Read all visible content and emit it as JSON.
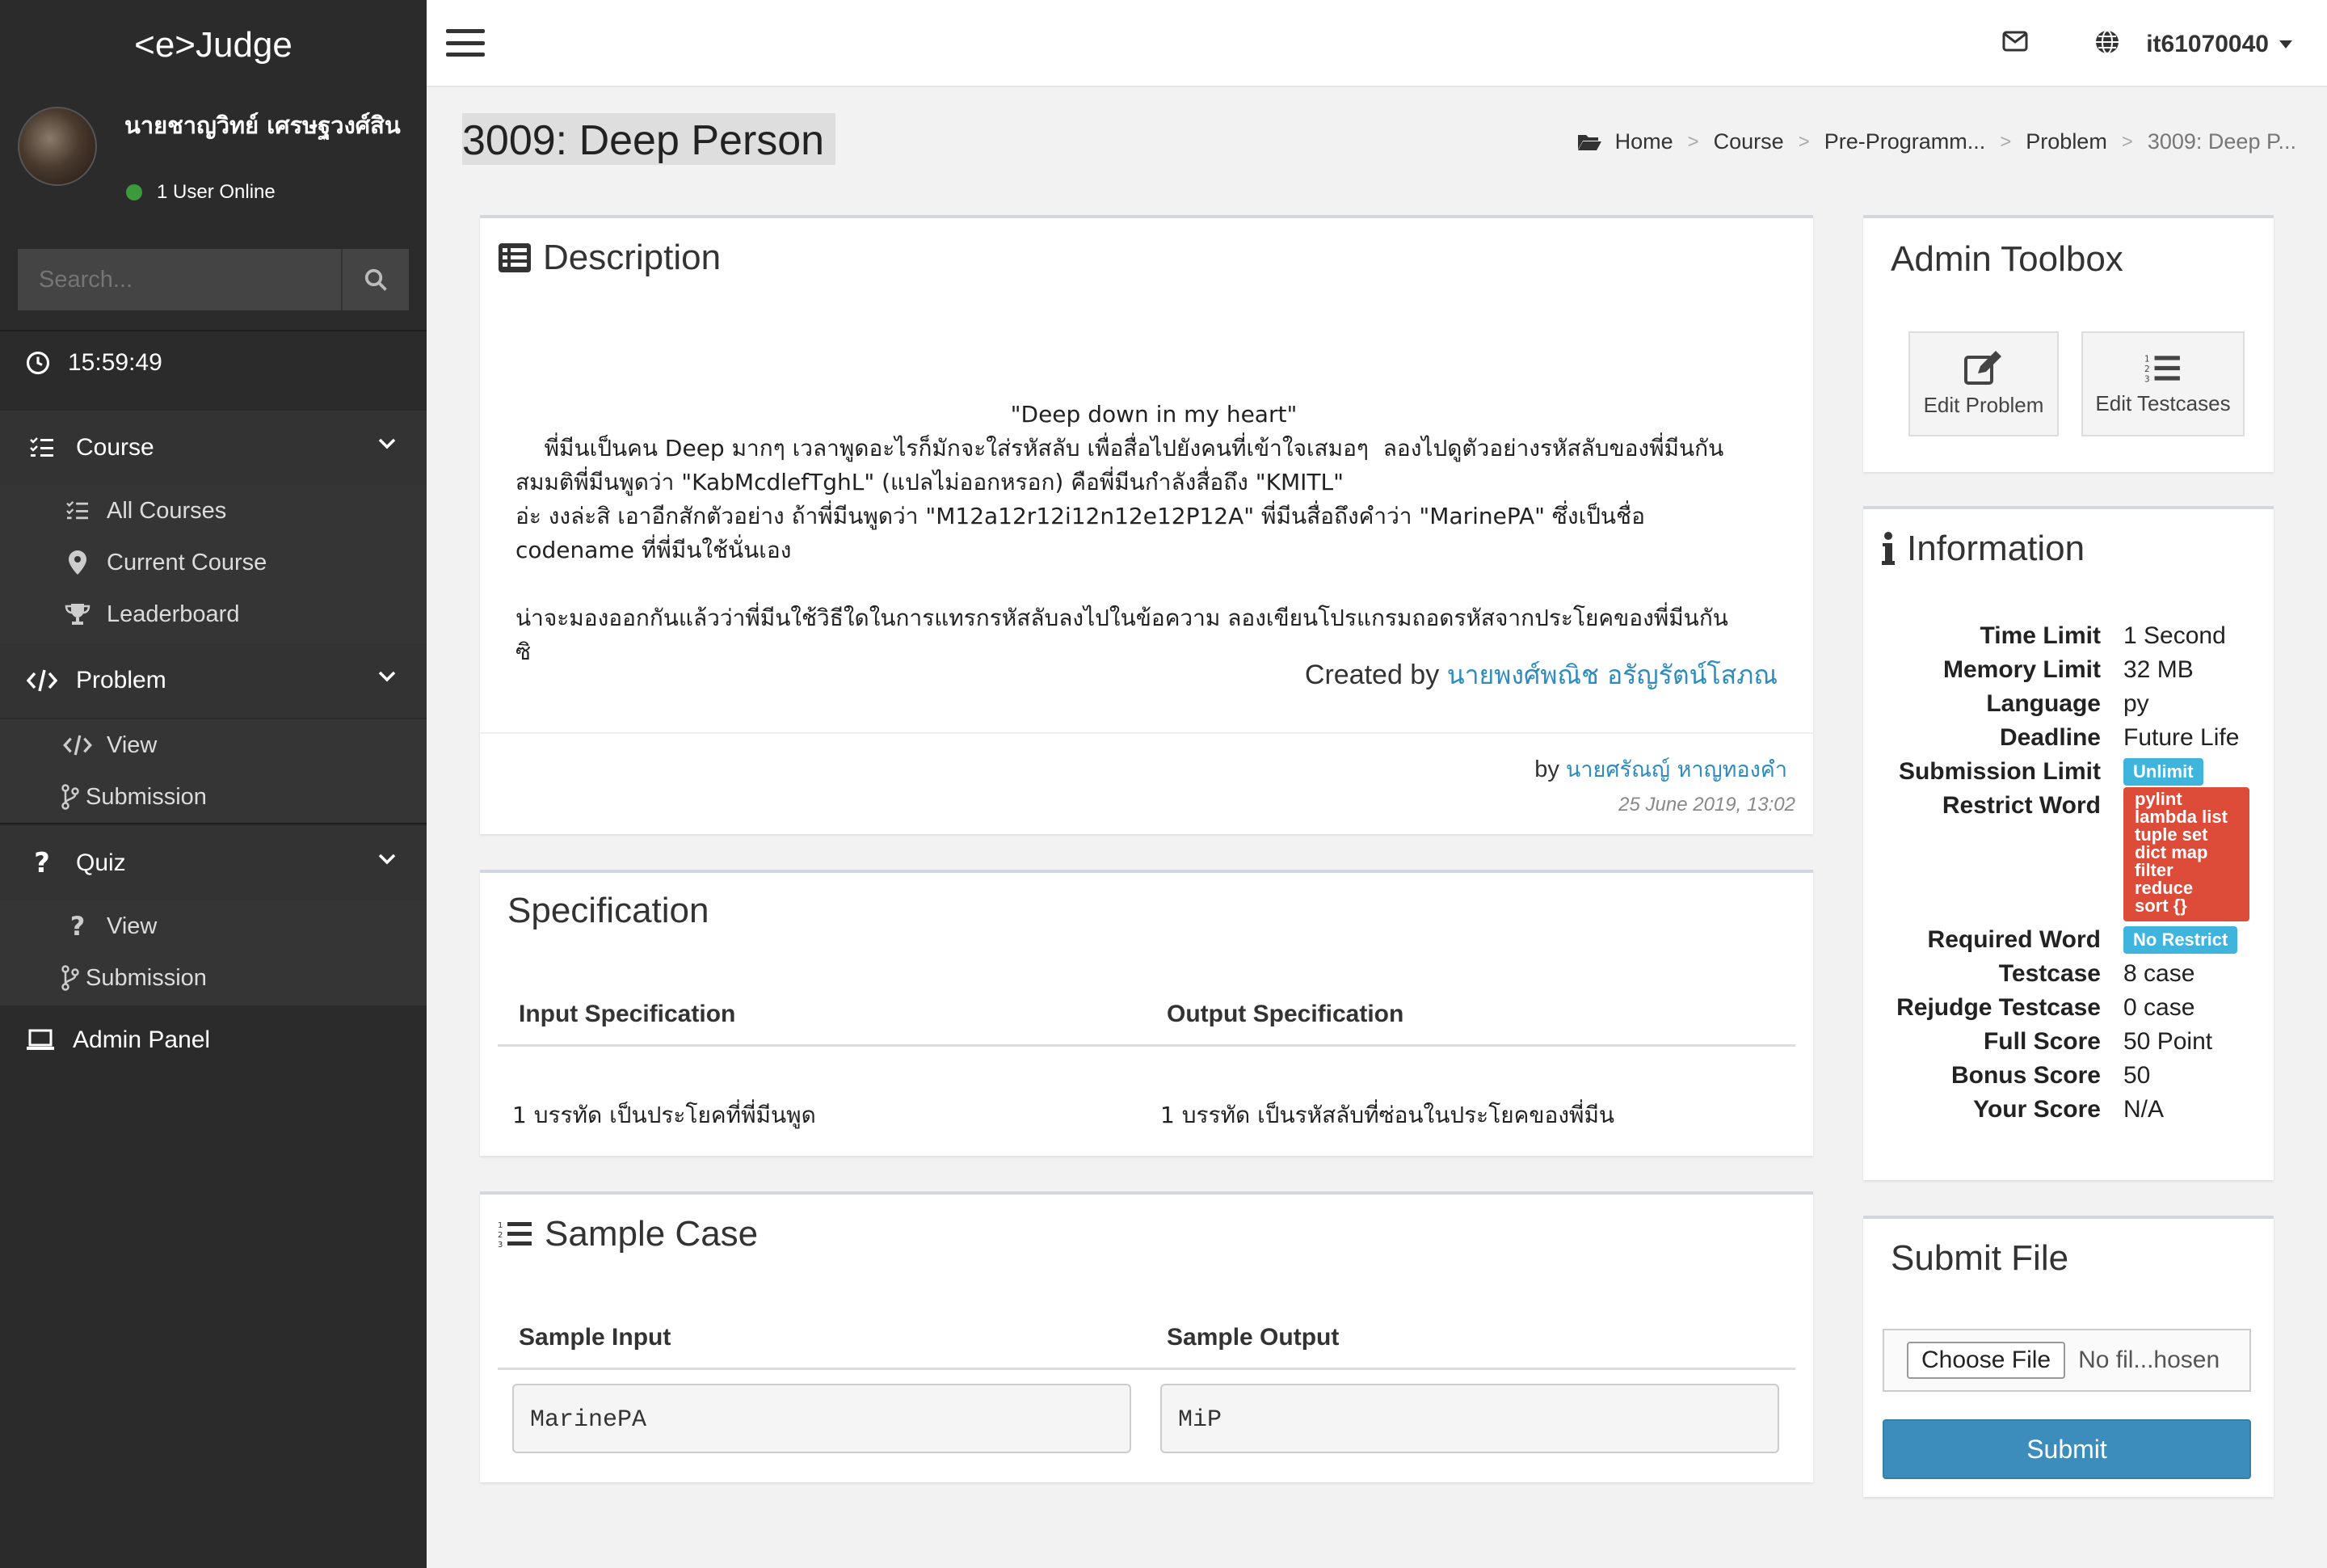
{
  "brand": "<e>Judge",
  "user": {
    "name": "นายชาญวิทย์ เศรษฐวงศ์สิน",
    "status": "1 User Online"
  },
  "search": {
    "placeholder": "Search..."
  },
  "clock": "15:59:49",
  "nav": {
    "course": {
      "label": "Course",
      "items": [
        "All Courses",
        "Current Course",
        "Leaderboard"
      ]
    },
    "problem": {
      "label": "Problem",
      "items": [
        "View",
        "Submission"
      ]
    },
    "quiz": {
      "label": "Quiz",
      "items": [
        "View",
        "Submission"
      ]
    },
    "admin": "Admin Panel"
  },
  "topbar": {
    "username": "it61070040"
  },
  "page": {
    "title": "3009: Deep Person"
  },
  "breadcrumb": [
    "Home",
    "Course",
    "Pre-Programm...",
    "Problem",
    "3009: Deep P..."
  ],
  "description": {
    "title": "Description",
    "quote": "\"Deep down in my heart\"",
    "lines": [
      "    พี่มีนเป็นคน Deep มากๆ เวลาพูดอะไรก็มักจะใส่รหัสลับ เพื่อสื่อไปยังคนที่เข้าใจเสมอๆ  ลองไปดูตัวอย่างรหัสลับของพี่มีนกัน",
      "สมมติพี่มีนพูดว่า \"KabMcdlefTghL\" (แปลไม่ออกหรอก) คือพี่มีนกำลังสื่อถึง \"KMITL\"",
      "อ่ะ งงล่ะสิ เอาอีกสักตัวอย่าง ถ้าพี่มีนพูดว่า \"M12a12r12i12n12e12P12A\" พี่มีนสื่อถึงคำว่า \"MarinePA\" ซึ่งเป็นชื่อ",
      "codename ที่พี่มีนใช้นั่นเอง",
      "",
      "น่าจะมองออกกันแล้วว่าพี่มีนใช้วิธีใดในการแทรกรหัสลับลงไปในข้อความ ลองเขียนโปรแกรมถอดรหัสจากประโยคของพี่มีนกัน",
      "ซิ"
    ],
    "created_prefix": "Created by",
    "created_by": "นายพงศ์พณิช อรัญรัตน์โสภณ",
    "by_prefix": "by",
    "by_author": "นายศรัณญ์ หาญทองคำ",
    "date": "25 June 2019, 13:02"
  },
  "specification": {
    "title": "Specification",
    "input_header": "Input Specification",
    "output_header": "Output Specification",
    "input": "1 บรรทัด เป็นประโยคที่พี่มีนพูด",
    "output": "1 บรรทัด เป็นรหัสลับที่ซ่อนในประโยคของพี่มีน"
  },
  "sample": {
    "title": "Sample Case",
    "input_header": "Sample Input",
    "output_header": "Sample Output",
    "input": "MarinePA",
    "output": "MiP"
  },
  "toolbox": {
    "title": "Admin Toolbox",
    "edit_problem": "Edit Problem",
    "edit_testcases": "Edit Testcases"
  },
  "information": {
    "title": "Information",
    "labels": {
      "time_limit": "Time Limit",
      "memory_limit": "Memory Limit",
      "language": "Language",
      "deadline": "Deadline",
      "submission_limit": "Submission Limit",
      "restrict_word": "Restrict Word",
      "required_word": "Required Word",
      "testcase": "Testcase",
      "rejudge_testcase": "Rejudge Testcase",
      "full_score": "Full Score",
      "bonus_score": "Bonus Score",
      "your_score": "Your Score"
    },
    "values": {
      "time_limit": "1 Second",
      "memory_limit": "32 MB",
      "language": "py",
      "deadline": "Future Life",
      "submission_limit": "Unlimit",
      "restrict_words": [
        "pylint",
        "lambda list",
        "tuple set",
        "dict map",
        "filter",
        "reduce",
        "sort {}"
      ],
      "required_word": "No Restrict",
      "testcase": "8 case",
      "rejudge_testcase": "0 case",
      "full_score": "50 Point",
      "bonus_score": "50",
      "your_score": "N/A"
    }
  },
  "submit": {
    "title": "Submit File",
    "choose_file": "Choose File",
    "no_file": "No fil...hosen",
    "button": "Submit"
  },
  "colors": {
    "sidebar": "#2b2b2b",
    "accent": "#3c8dbc",
    "link": "#2e8bc0",
    "badge_blue": "#3fb5de",
    "badge_red": "#dd4b39"
  }
}
